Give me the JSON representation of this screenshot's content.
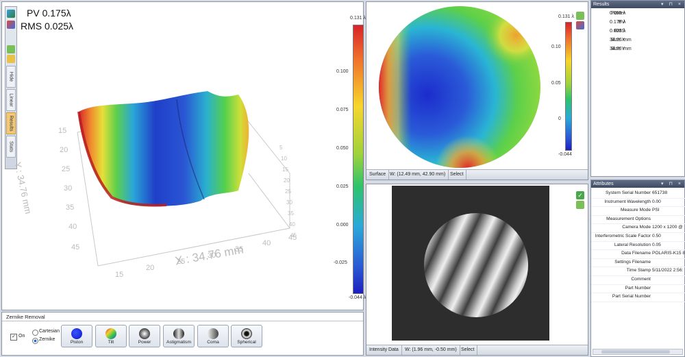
{
  "overlay": {
    "pv": "PV 0.175λ",
    "rms": "RMS 0.025λ"
  },
  "left_tabs": [
    {
      "label": "Hide"
    },
    {
      "label": "Linear"
    },
    {
      "label": "Results"
    },
    {
      "label": "Stats"
    }
  ],
  "plot3d": {
    "y_axis_label": "Y : 34.76 mm",
    "x_axis_label": "X : 34.76 mm",
    "y_ticks": [
      "15",
      "20",
      "25",
      "30",
      "35",
      "40",
      "45"
    ],
    "x_ticks": [
      "15",
      "20",
      "25",
      "30",
      "35",
      "40",
      "45"
    ],
    "side_ticks": [
      "5",
      "10",
      "15",
      "20",
      "25",
      "30",
      "35",
      "40",
      "45"
    ]
  },
  "main_scale": {
    "max_label": "0.131",
    "unit": "λ",
    "ticks": [
      "0.100",
      "0.075",
      "0.050",
      "0.025",
      "0.000",
      "-0.025"
    ],
    "min_label": "-0.044",
    "min_unit": "λ"
  },
  "surface_panel": {
    "scale_max": "0.131",
    "scale_unit": "λ",
    "scale_ticks": [
      "0.10",
      "0.05",
      "0"
    ],
    "scale_min": "-0.044",
    "status": {
      "name": "Surface",
      "coords": "W: (12.49 mm, 42.90 mm)",
      "action": "Select"
    }
  },
  "intensity_panel": {
    "status": {
      "name": "Intensity Data",
      "coords": "W: (1.96 mm, -0.50 mm)",
      "action": "Select"
    }
  },
  "results": {
    "title": "Results",
    "rows": [
      {
        "label": "Power",
        "value": "0.055",
        "unit": "λ"
      },
      {
        "label": "PV",
        "value": "0.175",
        "unit": "λ"
      },
      {
        "label": "RMS",
        "value": "0.025",
        "unit": "λ"
      },
      {
        "label": "Size X",
        "value": "34.76",
        "unit": "mm"
      },
      {
        "label": "Size Y",
        "value": "34.76",
        "unit": "mm"
      }
    ]
  },
  "attributes": {
    "title": "Attributes",
    "rows": [
      {
        "label": "System Serial Number",
        "value": "651738"
      },
      {
        "label": "Instrument Wavelength",
        "value": "0.00"
      },
      {
        "label": "Measure Mode",
        "value": "PSI"
      },
      {
        "label": "Measurement Options",
        "value": ""
      },
      {
        "label": "Camera Mode",
        "value": "1200 x 1200 @"
      },
      {
        "label": "Interferometric Scale Factor",
        "value": "0.50"
      },
      {
        "label": "Lateral Resolution",
        "value": "0.05"
      },
      {
        "label": "Data Filename",
        "value": "POLARIS-K15 80"
      },
      {
        "label": "Settings Filename",
        "value": ""
      },
      {
        "label": "Time Stamp",
        "value": "5/11/2022 2:56:"
      },
      {
        "label": "Comment",
        "value": ""
      },
      {
        "label": "Part Number",
        "value": ""
      },
      {
        "label": "Part Serial Number",
        "value": ""
      }
    ]
  },
  "zernike": {
    "title": "Zernike Removal",
    "on_label": "On",
    "cartesian_label": "Cartesian",
    "zernike_label": "Zernike",
    "buttons": [
      {
        "label": "Piston"
      },
      {
        "label": "Tilt"
      },
      {
        "label": "Power"
      },
      {
        "label": "Astigmatism"
      },
      {
        "label": "Coma"
      },
      {
        "label": "Spherical"
      }
    ]
  }
}
